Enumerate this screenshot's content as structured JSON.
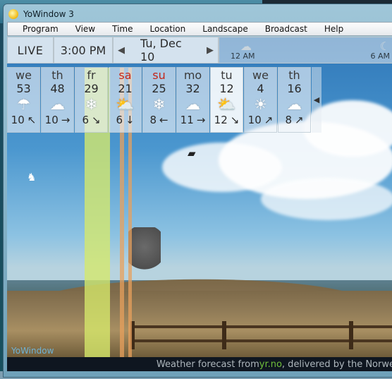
{
  "window": {
    "title": "YoWindow 3"
  },
  "menu": [
    "Program",
    "View",
    "Time",
    "Location",
    "Landscape",
    "Broadcast",
    "Help"
  ],
  "info": {
    "live_label": "LIVE",
    "time": "3:00 PM",
    "date": "Tu, Dec 10",
    "timeline": {
      "label_left": "12 AM",
      "label_right": "6 AM"
    }
  },
  "forecast": [
    {
      "day": "we",
      "temp": "53",
      "icon": "rain-icon",
      "wind": "10",
      "dir": "↖",
      "red": false,
      "selected": false
    },
    {
      "day": "th",
      "temp": "48",
      "icon": "cloud-icon",
      "wind": "10",
      "dir": "→",
      "red": false,
      "selected": false
    },
    {
      "day": "fr",
      "temp": "29",
      "icon": "snow-icon",
      "wind": "6",
      "dir": "↘",
      "red": false,
      "selected": false
    },
    {
      "day": "sa",
      "temp": "21",
      "icon": "partly-cloudy-icon",
      "wind": "6",
      "dir": "↓",
      "red": true,
      "selected": false
    },
    {
      "day": "su",
      "temp": "25",
      "icon": "snow-icon",
      "wind": "8",
      "dir": "←",
      "red": true,
      "selected": false
    },
    {
      "day": "mo",
      "temp": "32",
      "icon": "cloud-icon",
      "wind": "11",
      "dir": "→",
      "red": false,
      "selected": false
    },
    {
      "day": "tu",
      "temp": "12",
      "icon": "partly-cloudy-icon",
      "wind": "12",
      "dir": "↘",
      "red": false,
      "selected": true
    },
    {
      "day": "we",
      "temp": "4",
      "icon": "sun-icon",
      "wind": "10",
      "dir": "↗",
      "red": false,
      "selected": false
    },
    {
      "day": "th",
      "temp": "16",
      "icon": "cloud-icon",
      "wind": "8",
      "dir": "↗",
      "red": false,
      "selected": false
    }
  ],
  "watermark": "YoWindow",
  "status": {
    "prefix": "Weather forecast from ",
    "source": "yr.no",
    "suffix": ", delivered by the Norwe"
  },
  "colors": {
    "weekend_day": "#c3261a",
    "link": "#6fbf3a",
    "statusbar_bg": "#0f1620"
  }
}
